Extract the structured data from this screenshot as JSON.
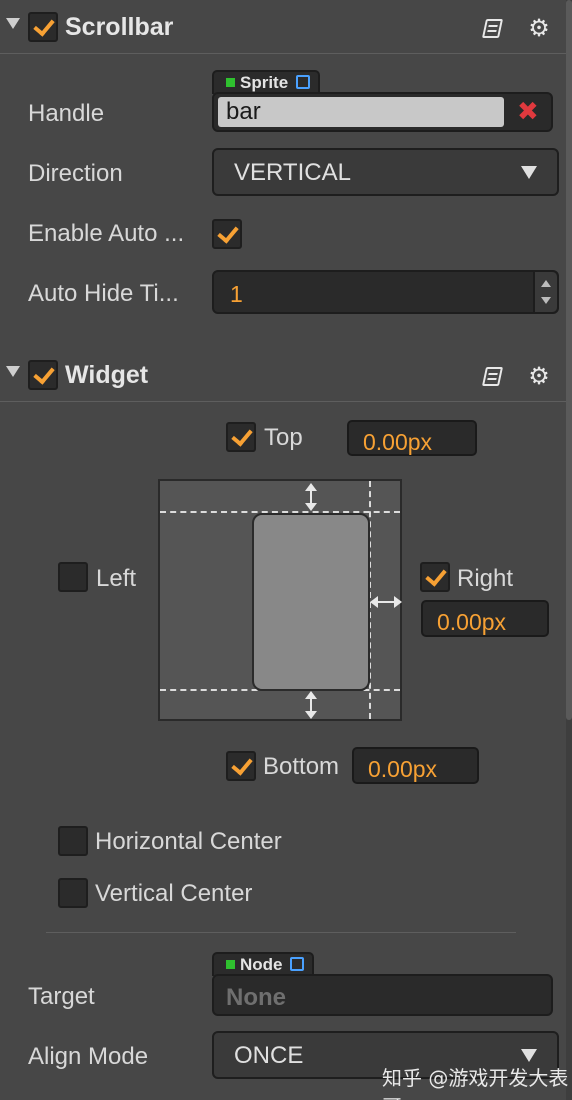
{
  "scrollbar_section": {
    "title": "Scrollbar",
    "enabled": true,
    "handle": {
      "label": "Handle",
      "type_tag": "Sprite",
      "value": "bar"
    },
    "direction": {
      "label": "Direction",
      "value": "VERTICAL"
    },
    "enable_auto_hide": {
      "label": "Enable Auto ...",
      "checked": true
    },
    "auto_hide_time": {
      "label": "Auto Hide Ti...",
      "value": "1"
    }
  },
  "widget_section": {
    "title": "Widget",
    "enabled": true,
    "top": {
      "label": "Top",
      "checked": true,
      "value": "0.00px"
    },
    "left": {
      "label": "Left",
      "checked": false
    },
    "right": {
      "label": "Right",
      "checked": true,
      "value": "0.00px"
    },
    "bottom": {
      "label": "Bottom",
      "checked": true,
      "value": "0.00px"
    },
    "horizontal_center": {
      "label": "Horizontal Center",
      "checked": false
    },
    "vertical_center": {
      "label": "Vertical Center",
      "checked": false
    },
    "target": {
      "label": "Target",
      "type_tag": "Node",
      "value": "None"
    },
    "align_mode": {
      "label": "Align Mode",
      "value": "ONCE"
    }
  },
  "icons": {
    "fold": "triangle-down-icon",
    "help": "book-icon",
    "settings": "gear-icon",
    "clear": "close-icon",
    "link": "external-link-icon"
  },
  "colors": {
    "accent": "#f7a134",
    "panel_bg": "#474747",
    "field_bg": "#2a2a2a",
    "clear_red": "#e0393e",
    "tag_dot": "#2fc12f",
    "link_blue": "#4aa1ff"
  },
  "watermark": "知乎 @游戏开发大表哥"
}
